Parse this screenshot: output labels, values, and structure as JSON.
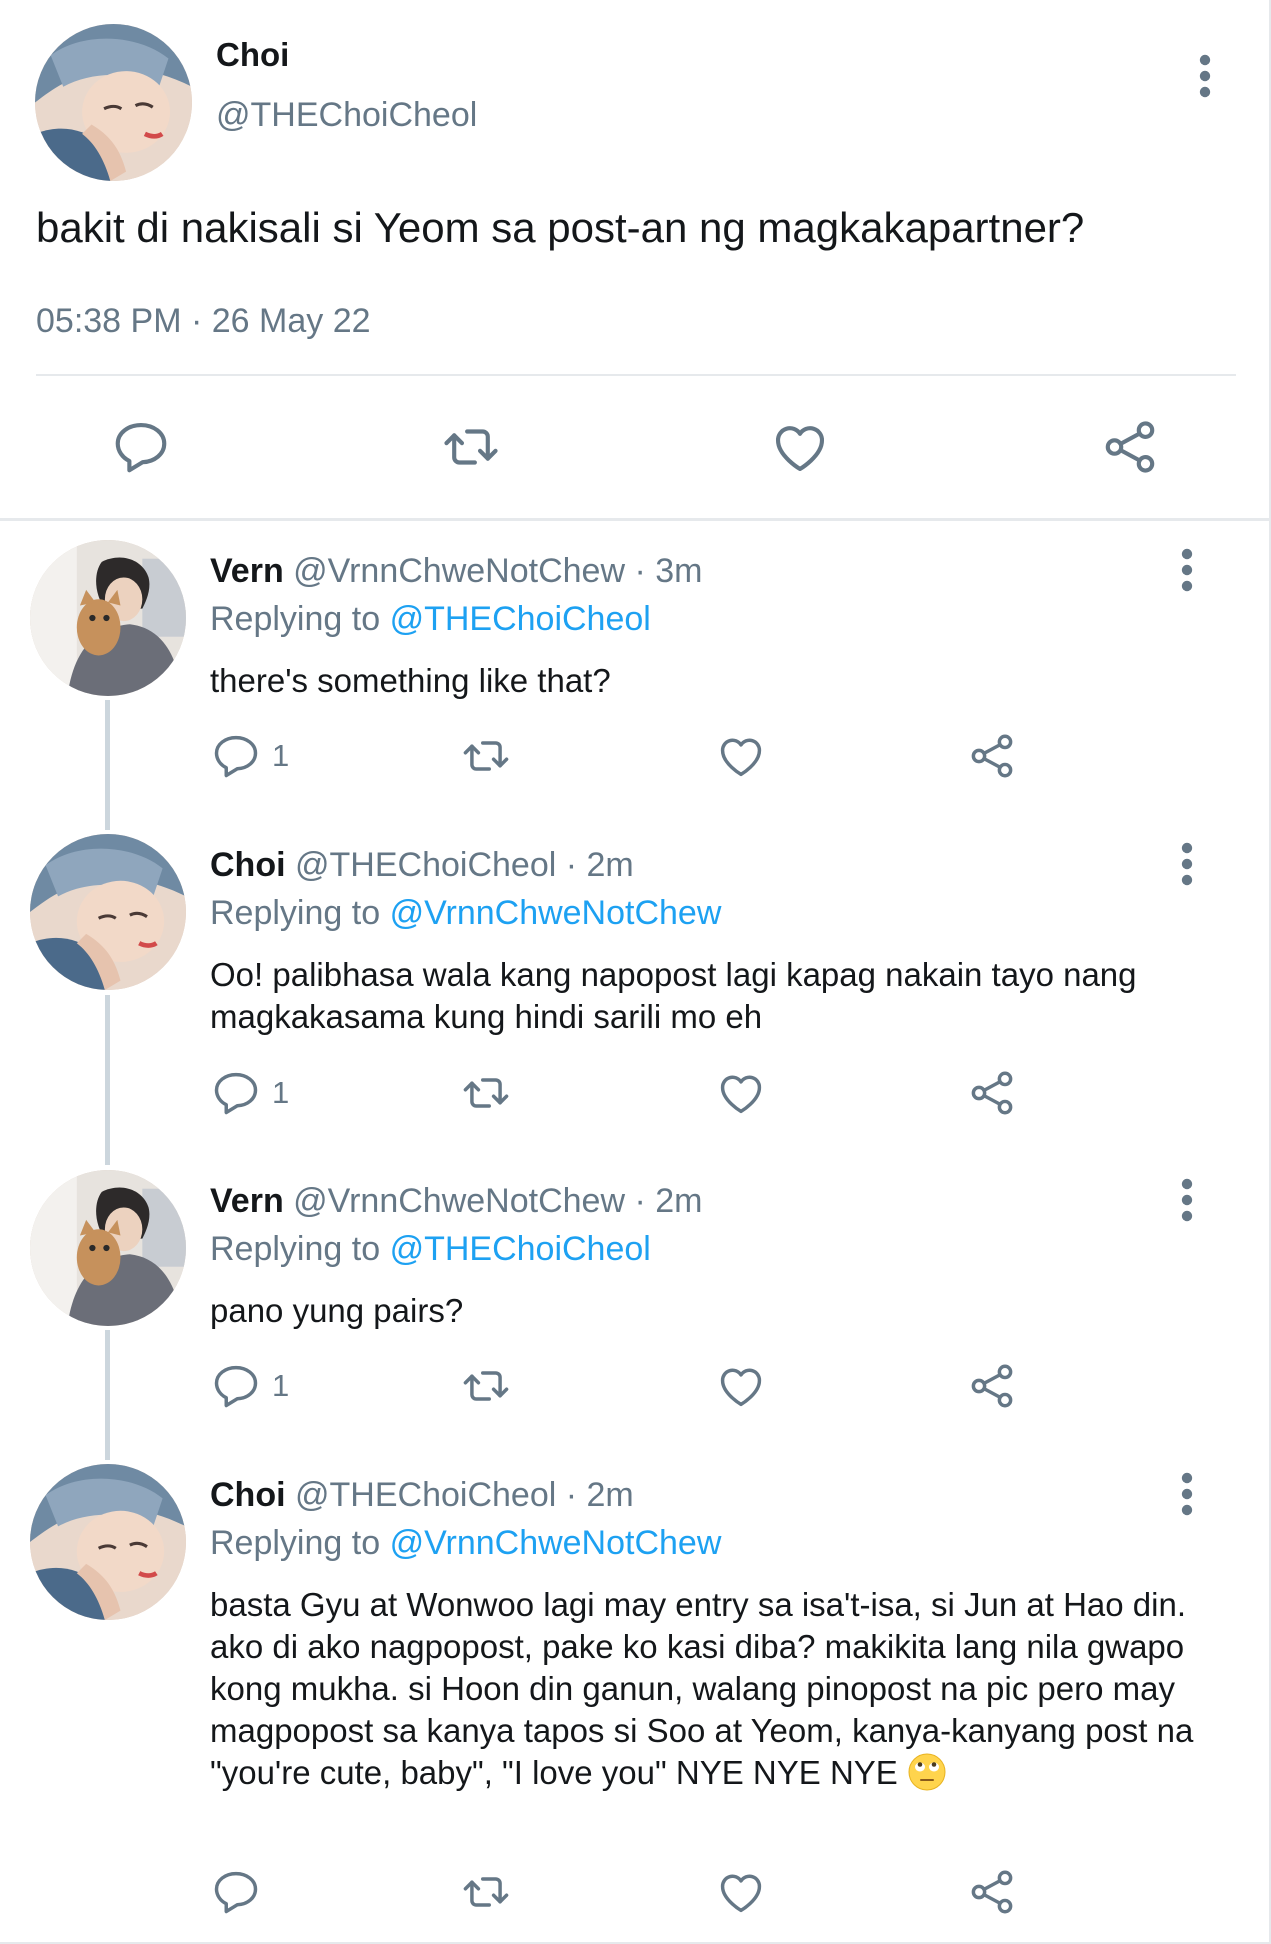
{
  "main_tweet": {
    "author_name": "Choi",
    "author_handle": "@THEChoiCheol",
    "text": "bakit di nakisali si Yeom sa post-an ng magkakapartner?",
    "time": "05:38 PM",
    "date": "26 May 22"
  },
  "replies": [
    {
      "name": "Vern",
      "handle": "@VrnnChweNotChew",
      "time": "3m",
      "replying_prefix": "Replying to",
      "replying_to": "@THEChoiCheol",
      "text": "there's something like that?",
      "reply_count": "1"
    },
    {
      "name": "Choi",
      "handle": "@THEChoiCheol",
      "time": "2m",
      "replying_prefix": "Replying to",
      "replying_to": "@VrnnChweNotChew",
      "text": "Oo! palibhasa wala kang napopost lagi kapag nakain tayo nang magkakasama kung hindi sarili mo eh",
      "reply_count": "1"
    },
    {
      "name": "Vern",
      "handle": "@VrnnChweNotChew",
      "time": "2m",
      "replying_prefix": "Replying to",
      "replying_to": "@THEChoiCheol",
      "text": "pano yung pairs?",
      "reply_count": "1"
    },
    {
      "name": "Choi",
      "handle": "@THEChoiCheol",
      "time": "2m",
      "replying_prefix": "Replying to",
      "replying_to": "@VrnnChweNotChew",
      "text": "basta Gyu at Wonwoo lagi may entry sa isa't-isa, si Jun at Hao din. ako di ako nagpopost, pake ko kasi diba? makikita lang nila gwapo kong mukha. si Hoon din ganun, walang pinopost na pic pero may magpopost sa kanya tapos si Soo at Yeom, kanya-kanyang post na \"you're cute, baby\", \"I love you\" NYE NYE NYE",
      "emoji": "eye-roll-emoji",
      "reply_count": ""
    }
  ],
  "separator": "·",
  "colors": {
    "text": "#14171a",
    "secondary": "#657786",
    "link": "#1da1f2",
    "divider": "#e6e9ec",
    "thread_line": "#ccd6dd"
  },
  "icons": [
    "reply-icon",
    "retweet-icon",
    "like-icon",
    "share-icon",
    "more-options-icon"
  ]
}
